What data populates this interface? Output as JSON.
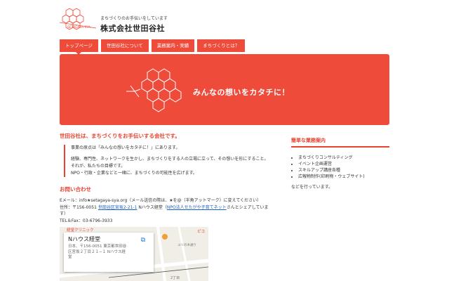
{
  "header": {
    "logo_text": "SETAGAYA-SYA",
    "tagline": "まちづくりのお手伝いをしています",
    "company": "株式会社世田谷社"
  },
  "nav": [
    {
      "label": "トップページ"
    },
    {
      "label": "世田谷社について"
    },
    {
      "label": "業務案内・実績"
    },
    {
      "label": "まちづくりとは？"
    }
  ],
  "hero": {
    "text": "みんなの想いをカタチに！"
  },
  "main": {
    "lead": "世田谷社は、まちづくりをお手伝いする会社です。",
    "quote_1": "事業の原点は「みんなの想いをカタチに！」にあります。",
    "quote_2": "経験、専門性、ネットワークを生かし、まちづくりをする人の立場に立って、その想いを形にすること。",
    "quote_3": "それが、私たちの目標です。",
    "quote_4": "NPO・行政・企業などと一緒に、まちづくりの可能性を広げます。",
    "contact_title": "お問い合わせ",
    "email": "Eメール：info★setagaya-sya.org（メール送信の際は、★を@（半角アットマーク）に変えてください）",
    "addr_prefix": "住所：〒156-0051",
    "addr_link": "世田谷区宮坂2-21-1",
    "addr_mid": "Nハウス経堂（",
    "npo_link": "NPO法人せたがや子育てネット",
    "addr_suffix": "さんとシェアしています）",
    "tel": "TEL＆Fax：03-6796-3933"
  },
  "map": {
    "name": "Nハウス経堂",
    "address": "日本、〒156-0051 東京都世田谷区宮坂２丁目２１−１ Nハウス経堂",
    "label_clinic": "経堂クリニック",
    "label_station": "ピコ",
    "label_street": "ユリの木通り",
    "label_chome": "2丁目"
  },
  "side": {
    "title": "簡単な業務案内",
    "items": [
      "まちづくりコンサルティング",
      "イベント企画運営",
      "スキルアップ講座各種",
      "広報物制作(印刷物・ウェブサイト)"
    ],
    "note": "などを行っています。"
  },
  "colors": {
    "accent": "#ef4b3a",
    "link": "#1a5fc4"
  }
}
